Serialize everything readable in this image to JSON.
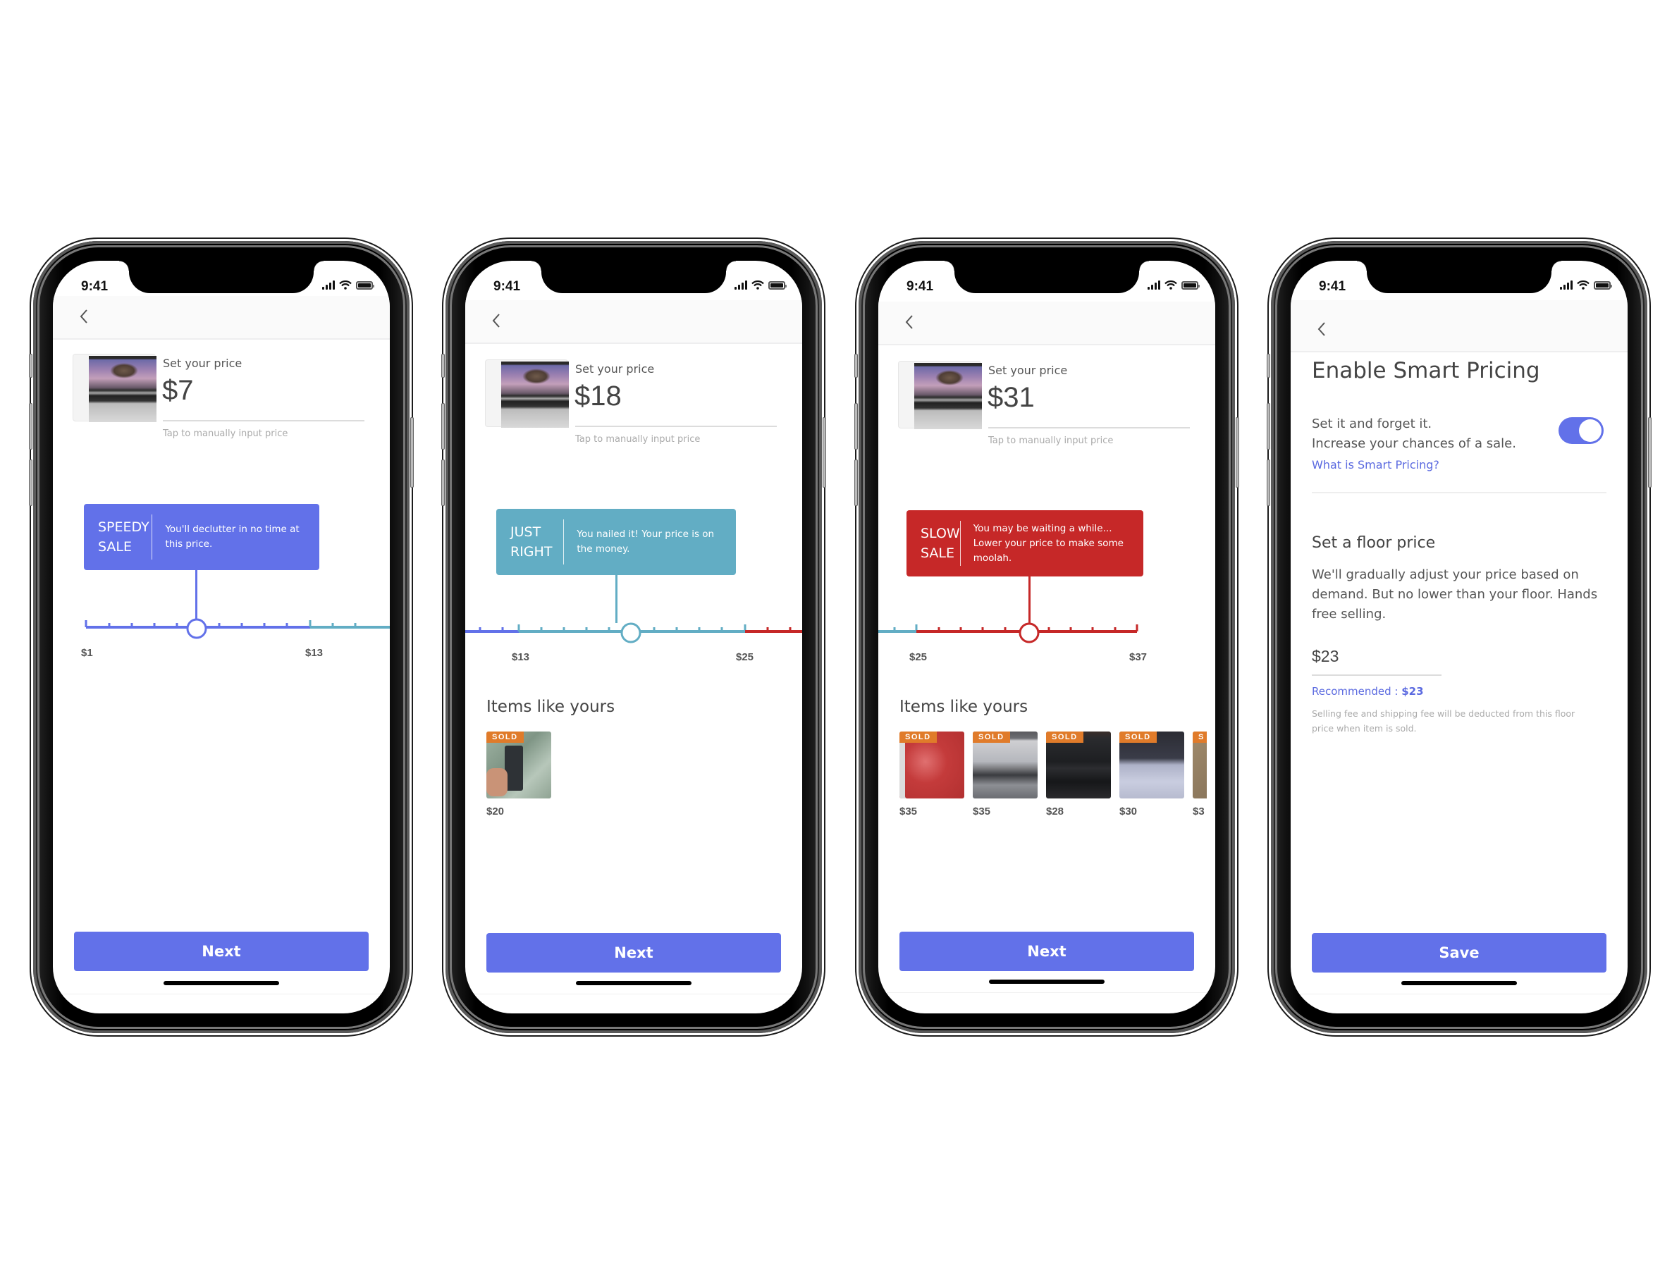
{
  "status_bar": {
    "time": "9:41"
  },
  "colors": {
    "speedy": "#6271e9",
    "just_right": "#62adc4",
    "slow": "#c62828",
    "primary": "#6271e9",
    "sold_badge": "#e07b2a",
    "link": "#5b6ae0"
  },
  "screens": [
    {
      "set_label": "Set your price",
      "price": "$7",
      "tap_hint": "Tap to manually input price",
      "tooltip": {
        "title_line1": "SPEEDY",
        "title_line2": "SALE",
        "text": "You'll declutter in no time at this price."
      },
      "slider": {
        "min_label": "$1",
        "max_label": "$13",
        "value": 7,
        "min": 1,
        "max": 13
      },
      "button": "Next"
    },
    {
      "set_label": "Set your price",
      "price": "$18",
      "tap_hint": "Tap to manually input price",
      "tooltip": {
        "title_line1": "JUST",
        "title_line2": "RIGHT",
        "text": "You nailed it! Your price is on the money."
      },
      "slider": {
        "min_label": "$13",
        "max_label": "$25",
        "value": 18,
        "min": 13,
        "max": 25
      },
      "items_title": "Items like yours",
      "items": [
        {
          "badge": "SOLD",
          "price": "$20"
        }
      ],
      "button": "Next"
    },
    {
      "set_label": "Set your price",
      "price": "$31",
      "tap_hint": "Tap to manually input price",
      "tooltip": {
        "title_line1": "SLOW",
        "title_line2": "SALE",
        "text": "You may be waiting a while... Lower your price to make some moolah."
      },
      "slider": {
        "min_label": "$25",
        "max_label": "$37",
        "value": 31,
        "min": 25,
        "max": 37
      },
      "items_title": "Items like yours",
      "items": [
        {
          "badge": "SOLD",
          "price": "$35"
        },
        {
          "badge": "SOLD",
          "price": "$35"
        },
        {
          "badge": "SOLD",
          "price": "$28"
        },
        {
          "badge": "SOLD",
          "price": "$30"
        },
        {
          "badge": "S",
          "price": "$3"
        }
      ],
      "button": "Next"
    },
    {
      "title": "Enable Smart Pricing",
      "subtitle_line1": "Set it and forget it.",
      "subtitle_line2": "Increase your chances of a sale.",
      "link": "What is Smart Pricing?",
      "toggle_on": true,
      "floor_title": "Set a floor price",
      "floor_desc": "We'll gradually adjust your price based on demand. But no lower than your floor. Hands free selling.",
      "floor_value": "$23",
      "recommended_label": "Recommended : ",
      "recommended_value": "$23",
      "fee_note": "Selling fee and shipping fee will be deducted from this floor price when item is sold.",
      "button": "Save"
    }
  ]
}
